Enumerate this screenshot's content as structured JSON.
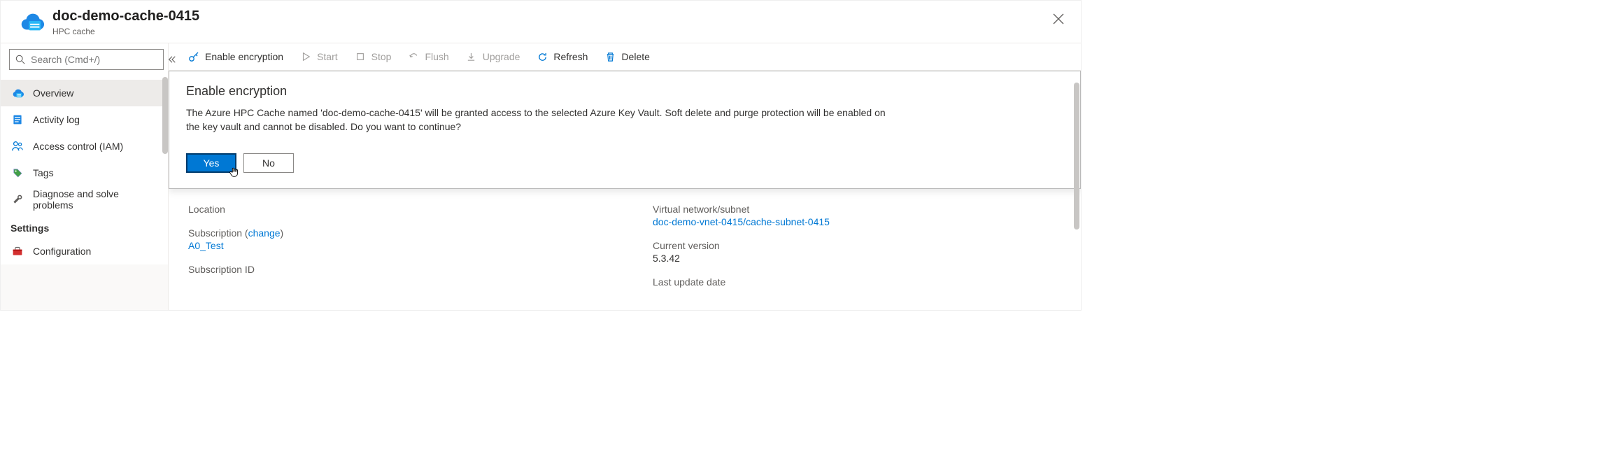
{
  "header": {
    "title": "doc-demo-cache-0415",
    "subtitle": "HPC cache"
  },
  "search": {
    "placeholder": "Search (Cmd+/)"
  },
  "sidebar": {
    "items": [
      {
        "label": "Overview",
        "icon": "cloud-file"
      },
      {
        "label": "Activity log",
        "icon": "log"
      },
      {
        "label": "Access control (IAM)",
        "icon": "people"
      },
      {
        "label": "Tags",
        "icon": "tag"
      },
      {
        "label": "Diagnose and solve problems",
        "icon": "wrench"
      }
    ],
    "settingsHeader": "Settings",
    "settingsItems": [
      {
        "label": "Configuration",
        "icon": "toolbox"
      }
    ]
  },
  "toolbar": {
    "enable_encryption": "Enable encryption",
    "start": "Start",
    "stop": "Stop",
    "flush": "Flush",
    "upgrade": "Upgrade",
    "refresh": "Refresh",
    "delete": "Delete"
  },
  "dialog": {
    "title": "Enable encryption",
    "text": "The Azure HPC Cache named 'doc-demo-cache-0415' will be granted access to the selected Azure Key Vault. Soft delete and purge protection will be enabled on the key vault and cannot be disabled. Do you want to continue?",
    "yes": "Yes",
    "no": "No"
  },
  "details": {
    "location_label": "Location",
    "subscription_label": "Subscription",
    "subscription_change": "change",
    "subscription_value": "A0_Test",
    "subscription_id_label": "Subscription ID",
    "vnet_label": "Virtual network/subnet",
    "vnet_value": "doc-demo-vnet-0415/cache-subnet-0415",
    "version_label": "Current version",
    "version_value": "5.3.42",
    "update_label": "Last update date"
  }
}
